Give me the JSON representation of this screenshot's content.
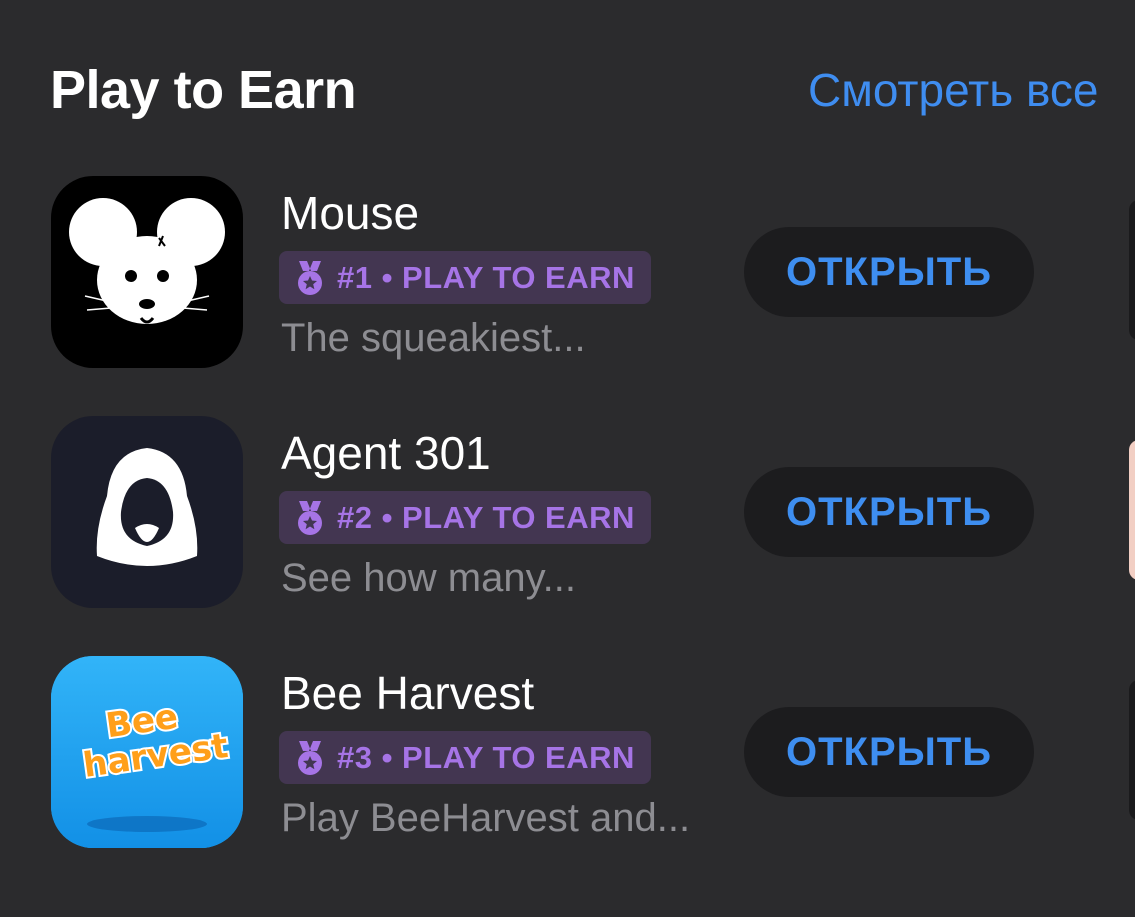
{
  "header": {
    "title": "Play to Earn",
    "see_all": "Смотреть все"
  },
  "apps": [
    {
      "name": "Mouse",
      "badge": "#1 • PLAY TO EARN",
      "description": "The squeakiest...",
      "button": "ОТКРЫТЬ",
      "icon": "mouse-icon"
    },
    {
      "name": "Agent 301",
      "badge": "#2 • PLAY TO EARN",
      "description": "See how many...",
      "button": "ОТКРЫТЬ",
      "icon": "hooded-agent-icon"
    },
    {
      "name": "Bee Harvest",
      "badge": "#3 • PLAY TO EARN",
      "description": "Play BeeHarvest and...",
      "button": "ОТКРЫТЬ",
      "icon": "bee-harvest-logo-icon"
    }
  ],
  "colors": {
    "background": "#2b2b2d",
    "accent": "#3f8df0",
    "badge_bg": "#433651",
    "badge_text": "#a674e6",
    "secondary_text": "#8d8d92",
    "button_bg": "#1c1c1e"
  }
}
